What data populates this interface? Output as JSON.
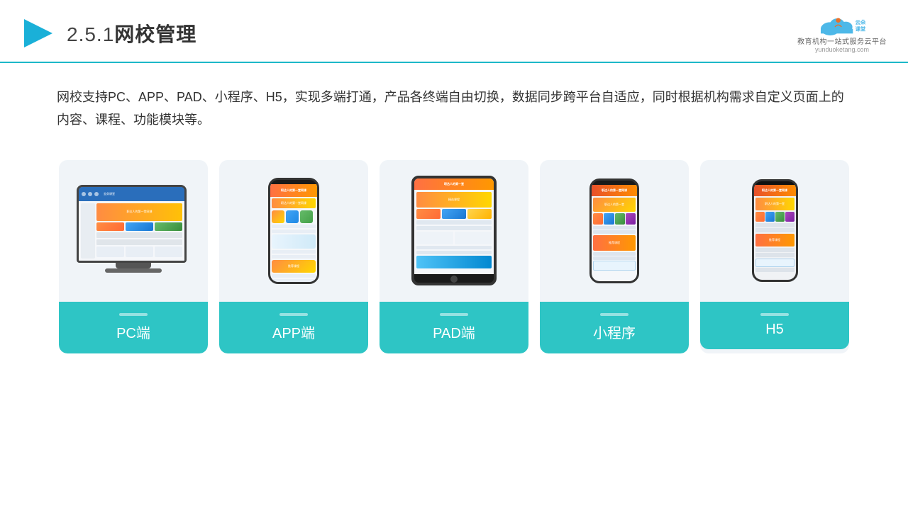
{
  "header": {
    "title": "网校管理",
    "section": "2.5.1",
    "logo": {
      "name": "云朵课堂",
      "url": "yunduoketang.com",
      "tagline": "教育机构一站式服务云平台"
    }
  },
  "description": {
    "text": "网校支持PC、APP、PAD、小程序、H5，实现多端打通，产品各终端自由切换，数据同步跨平台自适应，同时根据机构需求自定义页面上的内容、课程、功能模块等。"
  },
  "cards": [
    {
      "id": "pc",
      "label": "PC端"
    },
    {
      "id": "app",
      "label": "APP端"
    },
    {
      "id": "pad",
      "label": "PAD端"
    },
    {
      "id": "miniprogram",
      "label": "小程序"
    },
    {
      "id": "h5",
      "label": "H5"
    }
  ],
  "colors": {
    "accent": "#2ec5c5",
    "border": "#1db8c8",
    "bg_card": "#f0f4f8",
    "label_bg": "#2ec5c5"
  }
}
